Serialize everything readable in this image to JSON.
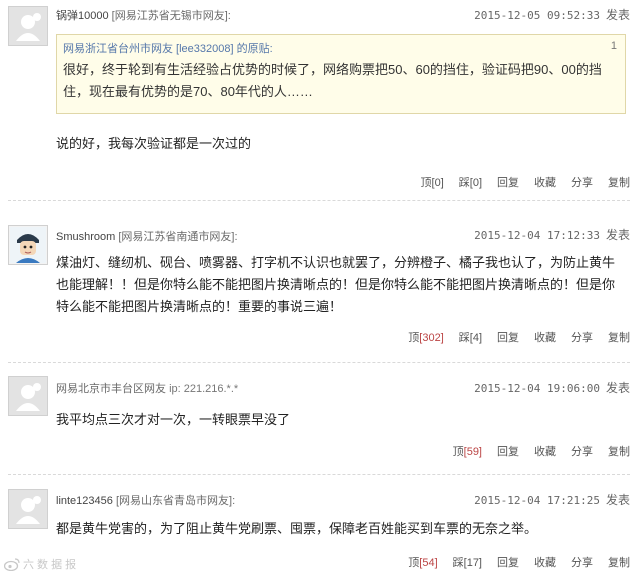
{
  "comments": [
    {
      "user": "锅弹10000",
      "location": "[网易江苏省无锡市网友]:",
      "time": "2015-12-05 09:52:33",
      "publish": "发表",
      "quote": {
        "header": "网易浙江省台州市网友 [lee332008] 的原贴:",
        "number": "1",
        "text": "很好，终于轮到有生活经验占优势的时候了，网络购票把50、60的挡住，验证码把90、00的挡住，现在最有优势的是70、80年代的人……"
      },
      "text": "说的好，我每次验证都是一次过的",
      "actions": {
        "top_label": "顶",
        "top_count": "[0]",
        "down_label": "踩",
        "down_count": "[0]",
        "reply": "回复",
        "favorite": "收藏",
        "share": "分享",
        "copy": "复制"
      }
    },
    {
      "user": "Smushroom",
      "location": "[网易江苏省南通市网友]:",
      "time": "2015-12-04 17:12:33",
      "publish": "发表",
      "text": "煤油灯、缝纫机、砚台、喷雾器、打字机不认识也就罢了，分辨橙子、橘子我也认了，为防止黄牛也能理解！！但是你特么能不能把图片换清晰点的！但是你特么能不能把图片换清晰点的！但是你特么能不能把图片换清晰点的！重要的事说三遍！",
      "actions": {
        "top_label": "顶",
        "top_count": "[302]",
        "down_label": "踩",
        "down_count": "[4]",
        "reply": "回复",
        "favorite": "收藏",
        "share": "分享",
        "copy": "复制"
      }
    },
    {
      "user": "网易北京市丰台区网友",
      "ip": "ip: 221.216.*.*",
      "time": "2015-12-04 19:06:00",
      "publish": "发表",
      "text": "我平均点三次才对一次，一转眼票早没了",
      "actions": {
        "top_label": "顶",
        "top_count": "[59]",
        "reply": "回复",
        "favorite": "收藏",
        "share": "分享",
        "copy": "复制"
      }
    },
    {
      "user": "linte123456",
      "location": "[网易山东省青岛市网友]:",
      "time": "2015-12-04 17:21:25",
      "publish": "发表",
      "text": "都是黄牛党害的，为了阻止黄牛党刷票、囤票，保障老百姓能买到车票的无奈之举。",
      "actions": {
        "top_label": "顶",
        "top_count": "[54]",
        "down_label": "踩",
        "down_count": "[17]",
        "reply": "回复",
        "favorite": "收藏",
        "share": "分享",
        "copy": "复制"
      }
    }
  ],
  "watermark": "六 数 据 报",
  "icons": {
    "default_avatar": "default-avatar-icon",
    "user_avatar": "mushroom-avatar-icon",
    "watermark": "weibo-icon"
  },
  "colors": {
    "quote_bg": "#fffde9",
    "link": "#5577aa",
    "count": "#b44444"
  }
}
